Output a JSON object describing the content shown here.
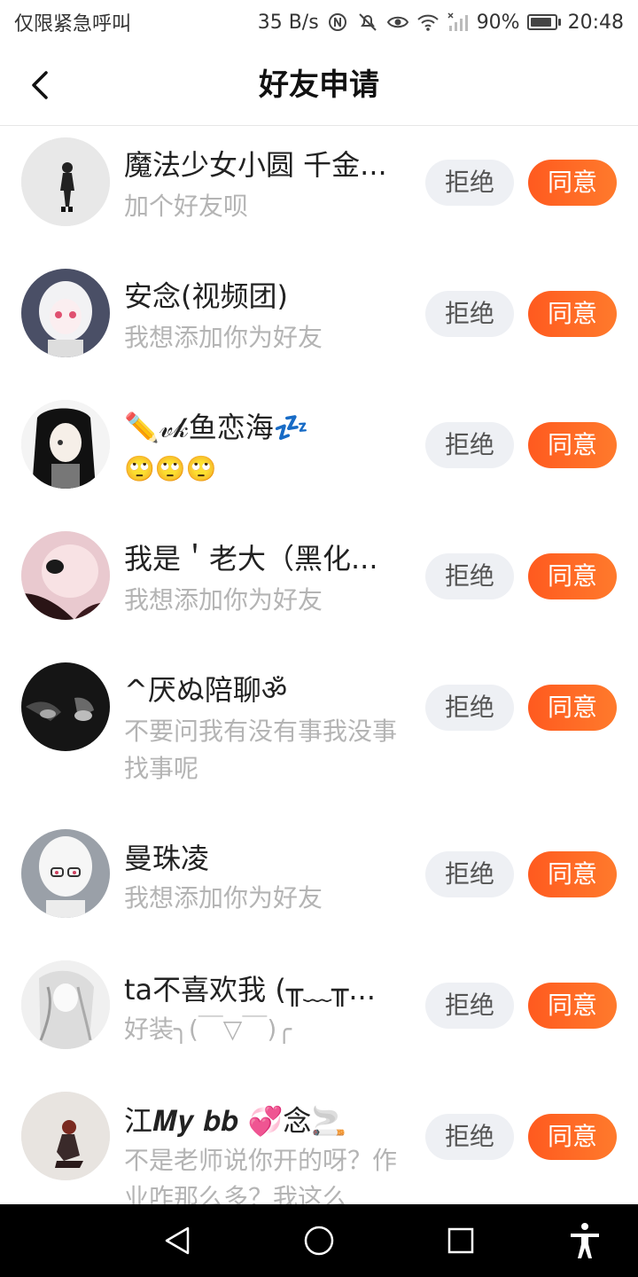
{
  "status_bar": {
    "carrier": "仅限紧急呼叫",
    "speed": "35 B/s",
    "battery": "90%",
    "battery_level": 0.9,
    "time": "20:48",
    "icons": [
      "nfc-icon",
      "mute-icon",
      "eye-icon",
      "wifi-icon",
      "signal-icon",
      "battery-icon"
    ]
  },
  "header": {
    "title": "好友申请",
    "back_icon": "back-arrow-icon"
  },
  "requests": [
    {
      "name": "魔法少女小圆 千金...",
      "message": "加个好友呗",
      "reject": "拒绝",
      "accept": "同意"
    },
    {
      "name": "安念(视频团)",
      "message": "我想添加你为好友",
      "reject": "拒绝",
      "accept": "同意"
    },
    {
      "name": "✏️𝓋𝓀鱼恋海💤",
      "message": "🙄🙄🙄",
      "reject": "拒绝",
      "accept": "同意"
    },
    {
      "name": "我是＇老大（黑化...",
      "message": "我想添加你为好友",
      "reject": "拒绝",
      "accept": "同意"
    },
    {
      "name": "^厌ぬ陪聊ॐ",
      "message": "不要问我有没有事我没事找事呢",
      "reject": "拒绝",
      "accept": "同意"
    },
    {
      "name": "曼珠凌",
      "message": "我想添加你为好友",
      "reject": "拒绝",
      "accept": "同意"
    },
    {
      "name": "ta不喜欢我 (╥﹏╥...",
      "message": "好装╮(￣▽￣)╭",
      "reject": "拒绝",
      "accept": "同意"
    },
    {
      "name": "江𝑴𝒚 𝒃𝒃 💞念🚬",
      "message": "不是老师说你开的呀？作业咋那么多？我这么",
      "reject": "拒绝",
      "accept": "同意"
    }
  ],
  "nav_bar": {
    "icons": [
      "back-triangle-icon",
      "home-circle-icon",
      "recents-square-icon",
      "accessibility-icon"
    ]
  }
}
